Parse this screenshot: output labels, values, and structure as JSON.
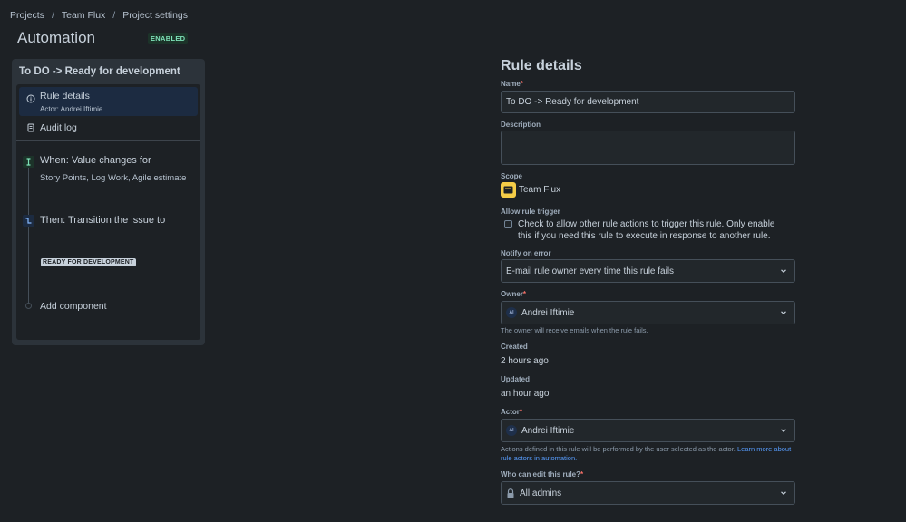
{
  "breadcrumb": {
    "items": [
      "Projects",
      "Team Flux",
      "Project settings"
    ],
    "separator": "/"
  },
  "header": {
    "title": "Automation",
    "status_badge": "ENABLED"
  },
  "rule_panel": {
    "title": "To DO -> Ready for development",
    "nav": [
      {
        "label": "Rule details",
        "sublabel": "Actor: Andrei Iftimie",
        "icon": "info-circle-icon",
        "active": true
      },
      {
        "label": "Audit log",
        "icon": "document-icon",
        "active": false
      }
    ],
    "trigger": {
      "title": "When: Value changes for",
      "detail": "Story Points, Log Work, Agile estimate",
      "icon": "field-change-icon"
    },
    "action": {
      "title": "Then: Transition the issue to",
      "status": "READY FOR DEVELOPMENT",
      "icon": "transition-icon"
    },
    "add_component_label": "Add component"
  },
  "form": {
    "heading": "Rule details",
    "name": {
      "label": "Name",
      "value": "To DO -> Ready for development"
    },
    "description": {
      "label": "Description",
      "value": ""
    },
    "scope": {
      "label": "Scope",
      "value": "Team Flux"
    },
    "allow_trigger": {
      "label": "Allow rule trigger",
      "text": "Check to allow other rule actions to trigger this rule. Only enable this if you need this rule to execute in response to another rule.",
      "checked": false
    },
    "notify": {
      "label": "Notify on error",
      "value": "E-mail rule owner every time this rule fails"
    },
    "owner": {
      "label": "Owner",
      "value": "Andrei Iftimie",
      "initials": "AI",
      "helper": "The owner will receive emails when the rule fails."
    },
    "created": {
      "label": "Created",
      "value": "2 hours ago"
    },
    "updated": {
      "label": "Updated",
      "value": "an hour ago"
    },
    "actor": {
      "label": "Actor",
      "value": "Andrei Iftimie",
      "initials": "AI",
      "helper": "Actions defined in this rule will be performed by the user selected as the actor.",
      "helper_link": "Learn more about rule actors in automation."
    },
    "editors": {
      "label": "Who can edit this rule?",
      "value": "All admins"
    },
    "required_mark": "*"
  },
  "colors": {
    "background": "#1d2125",
    "accent": "#579dff",
    "badge": "#7ee2b8",
    "scope_icon": "#f5cd47"
  }
}
